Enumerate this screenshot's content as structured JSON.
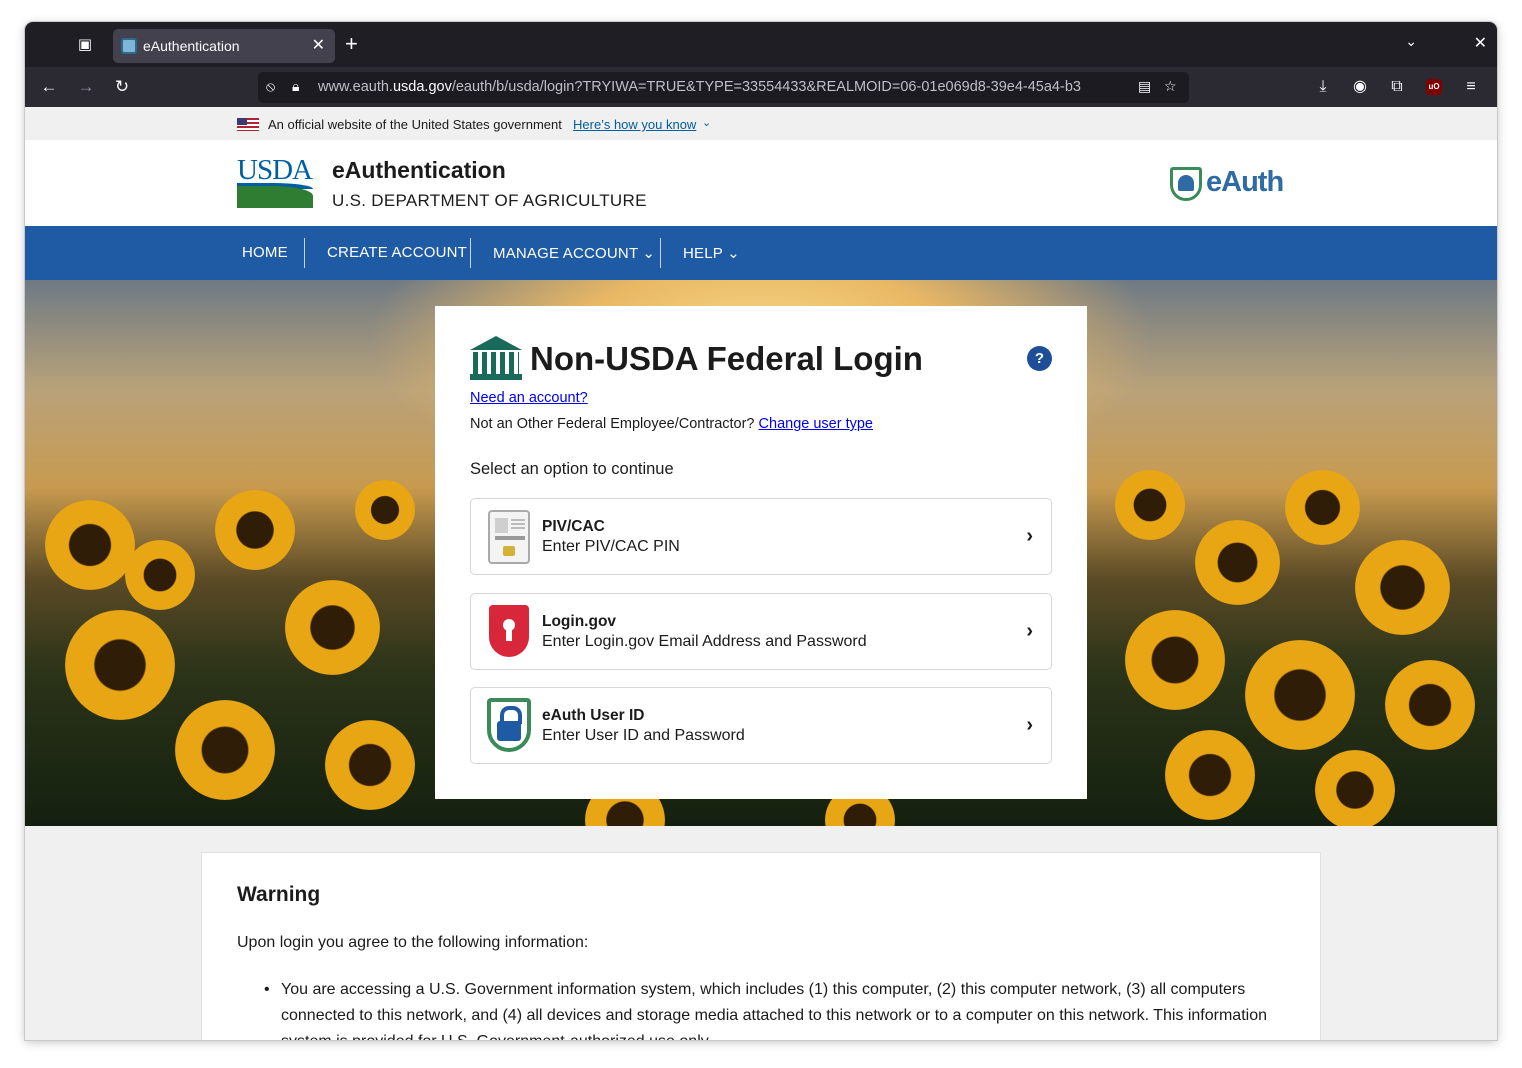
{
  "browser": {
    "tab_title": "eAuthentication",
    "url_prefix": "www.eauth.",
    "url_domain": "usda.gov",
    "url_path": "/eauth/b/usda/login?TRYIWA=TRUE&TYPE=33554433&REALMOID=06-01e069d8-39e4-45a4-b3"
  },
  "gov_banner": {
    "text": "An official website of the United States government",
    "link": "Here’s how you know"
  },
  "header": {
    "logo_text": "USDA",
    "title": "eAuthentication",
    "subtitle": "U.S. DEPARTMENT OF AGRICULTURE",
    "brand_logo_text": "eAuth"
  },
  "nav": {
    "home": "HOME",
    "create_account": "CREATE ACCOUNT",
    "manage_account": "MANAGE ACCOUNT",
    "help": "HELP"
  },
  "login": {
    "title": "Non-USDA Federal Login",
    "help_symbol": "?",
    "need_account": "Need an account?",
    "not_text": "Not an Other Federal Employee/Contractor? ",
    "change_user_type": "Change user type",
    "select_prompt": "Select an option to continue",
    "options": [
      {
        "name": "PIV/CAC",
        "desc": "Enter PIV/CAC PIN",
        "icon": "piv-card-icon"
      },
      {
        "name": "Login.gov",
        "desc": "Enter Login.gov Email Address and Password",
        "icon": "login-gov-shield-icon"
      },
      {
        "name": "eAuth User ID",
        "desc": "Enter User ID and Password",
        "icon": "eauth-lock-shield-icon"
      }
    ]
  },
  "warning": {
    "title": "Warning",
    "intro": "Upon login you agree to the following information:",
    "items": [
      "You are accessing a U.S. Government information system, which includes (1) this computer, (2) this computer network, (3) all computers connected to this network, and (4) all devices and storage media attached to this network or to a computer on this network. This information system is provided for U.S. Government-authorized use only."
    ]
  },
  "colors": {
    "nav_blue": "#1f5aa5",
    "usda_green": "#2e7d32",
    "link_blue": "#0000ee",
    "help_blue": "#1f4e99",
    "login_gov_red": "#d8263b"
  }
}
